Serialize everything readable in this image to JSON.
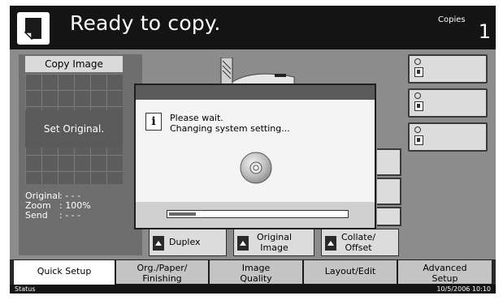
{
  "header": {
    "title": "Ready to copy.",
    "copies_label": "Copies",
    "copies_count": "1"
  },
  "preview": {
    "heading": "Copy Image",
    "set_original": "Set Original.",
    "info": [
      {
        "key": "Original",
        "value": ":  - - -"
      },
      {
        "key": "Zoom",
        "value": ":  100%"
      },
      {
        "key": "Send",
        "value": ":  - - -"
      }
    ]
  },
  "function_keys": [
    {
      "label": "Duplex"
    },
    {
      "label": "Original\nImage"
    },
    {
      "label": "Collate/\nOffset"
    }
  ],
  "tabs": [
    {
      "label": "Quick Setup",
      "active": true
    },
    {
      "label": "Org./Paper/\nFinishing",
      "active": false
    },
    {
      "label": "Image\nQuality",
      "active": false
    },
    {
      "label": "Layout/Edit",
      "active": false
    },
    {
      "label": "Advanced\nSetup",
      "active": false
    }
  ],
  "status": {
    "label": "Status",
    "datetime": "10/5/2006   10:10"
  },
  "dialog": {
    "line1": "Please wait.",
    "line2": "Changing system setting...",
    "progress": 0.15
  },
  "icons": {
    "document": "document-icon",
    "info": "info-icon",
    "disc": "cd-disc-icon"
  }
}
